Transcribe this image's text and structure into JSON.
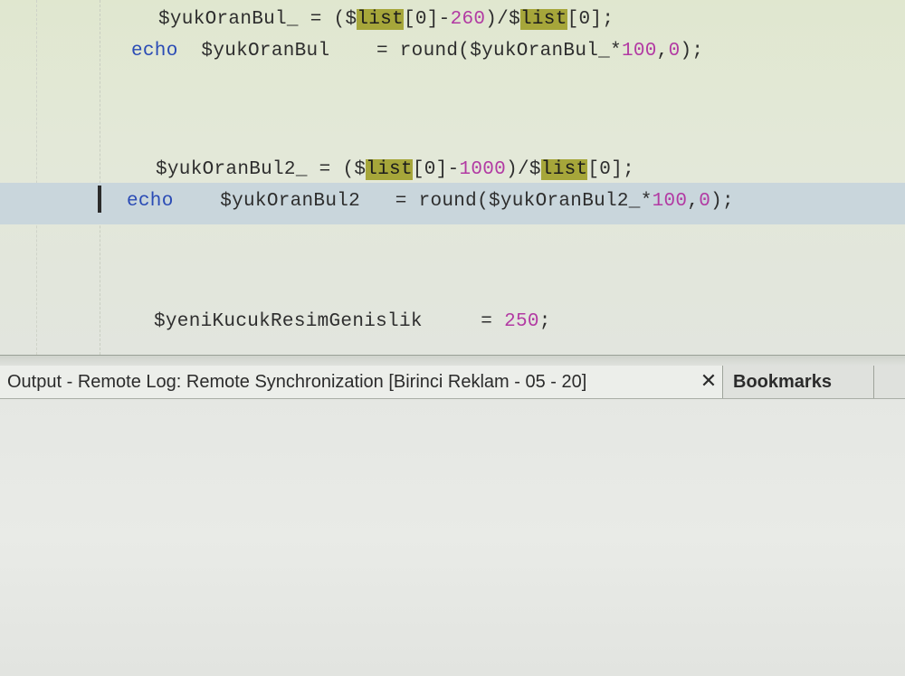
{
  "editor": {
    "cut_top": "_ = (\"\";",
    "line1": {
      "var": "$yukOranBul_",
      "eq": " = (",
      "d1": "$",
      "list": "list",
      "idx": "[0]-",
      "n": "260",
      "mid": ")/$",
      "list2": "list",
      "idx2": "[0]",
      "end": ";"
    },
    "line2": {
      "kw": "echo",
      "var": "$yukOranBul",
      "eq": " = round($yukOranBul_*",
      "n1": "100",
      "c": ",",
      "n2": "0",
      "end": ");"
    },
    "line3": {
      "var": "$yukOranBul2_",
      "eq": " = (",
      "d1": "$",
      "list": "list",
      "idx": "[0]-",
      "n": "1000",
      "mid": ")/$",
      "list2": "list",
      "idx2": "[0]",
      "end": ";"
    },
    "line4": {
      "kw": "echo",
      "var": "$yukOranBul2",
      "eq": " = round($yukOranBul2_*",
      "n1": "100",
      "c": ",",
      "n2": "0",
      "end": ");"
    },
    "line5": {
      "var": "$yeniKucukResimGenislik",
      "eq": " = ",
      "n": "250",
      "end": ";"
    }
  },
  "panel": {
    "output_tab": "Output - Remote Log: Remote Synchronization [Birinci Reklam - 05 - 20]",
    "close_symbol": "✕",
    "bookmarks_tab": "Bookmarks"
  },
  "colors": {
    "keyword": "#2a4bb5",
    "number": "#b23aa3",
    "highlight": "#a6a63a",
    "current_line": "#c9d6dc"
  }
}
